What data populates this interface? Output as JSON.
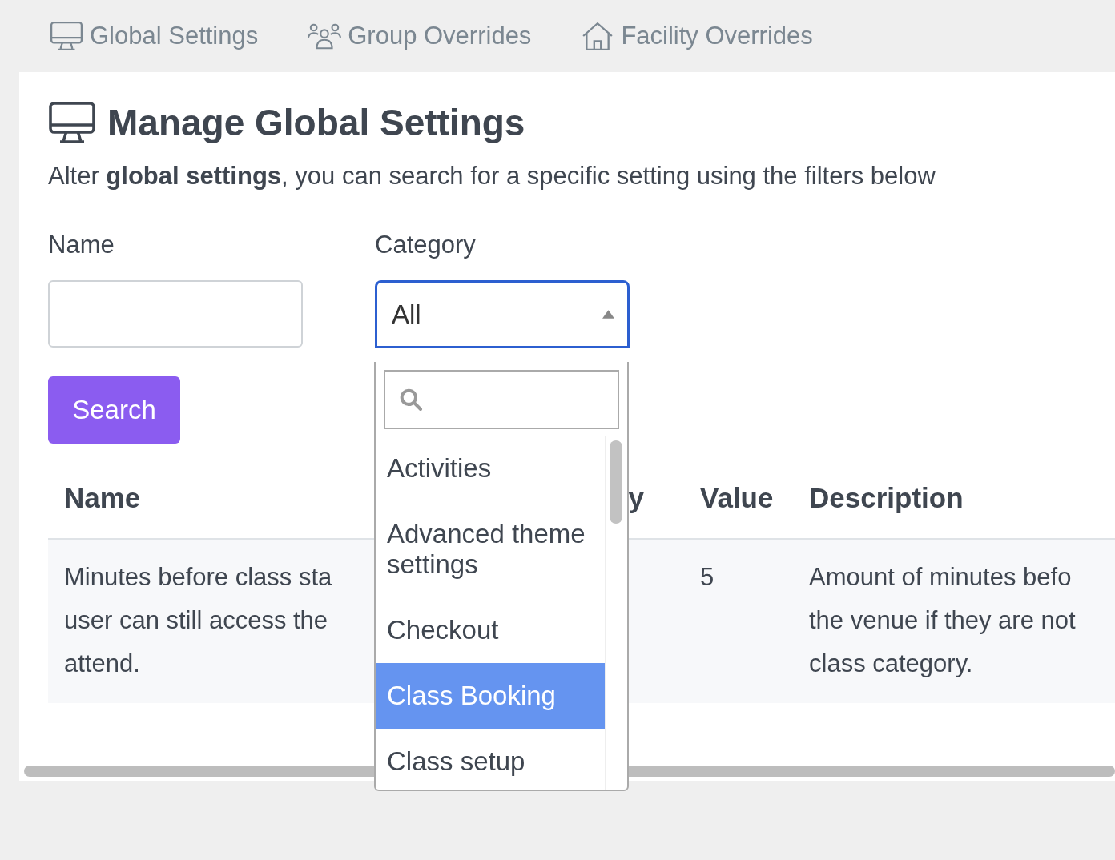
{
  "tabs": [
    {
      "label": "Global Settings"
    },
    {
      "label": "Group Overrides"
    },
    {
      "label": "Facility Overrides"
    }
  ],
  "heading": "Manage Global Settings",
  "subtitle": "Alter **global settings**, you can search for a specific setting using the filters below",
  "filters": {
    "name_label": "Name",
    "category_label": "Category",
    "category_value": "All",
    "search_button": "Search"
  },
  "table": {
    "columns": [
      "Name",
      "y",
      "Value",
      "Description"
    ],
    "rows": [
      {
        "name": [
          "Minutes before class sta",
          "user can still access the",
          "attend."
        ],
        "value": "5",
        "description": [
          "Amount of minutes befo",
          "the venue if they are not",
          "class category."
        ]
      }
    ]
  },
  "dropdown": {
    "options": [
      {
        "label": "Activities",
        "selected": false
      },
      {
        "label": "Advanced theme settings",
        "selected": false
      },
      {
        "label": "Checkout",
        "selected": false
      },
      {
        "label": "Class Booking",
        "selected": true
      },
      {
        "label": "Class setup",
        "selected": false
      }
    ]
  }
}
